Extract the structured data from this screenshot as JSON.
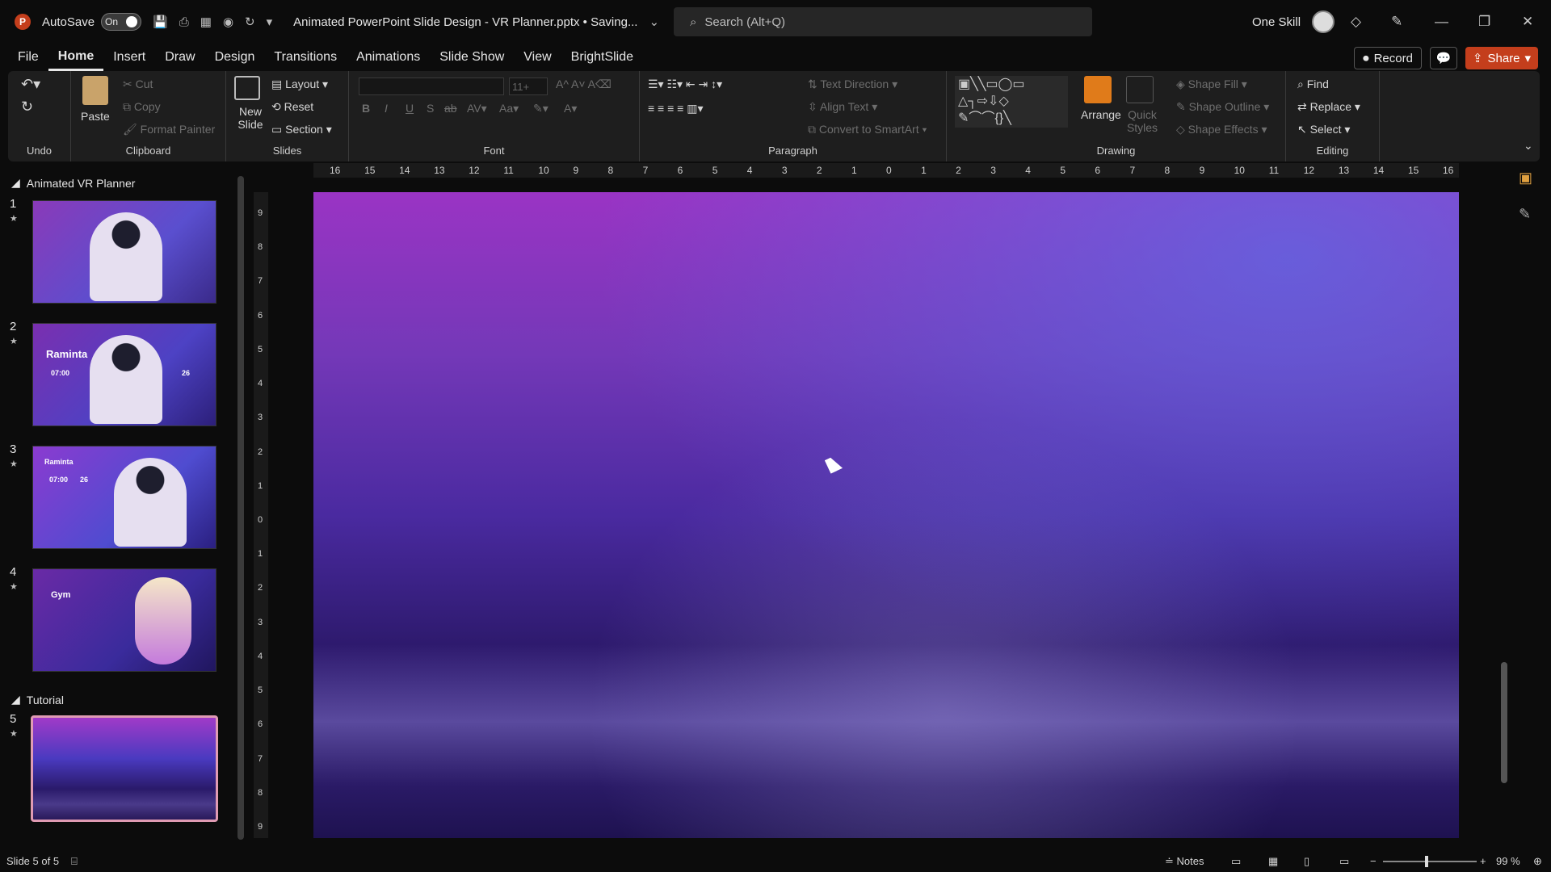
{
  "titlebar": {
    "app_icon": "P",
    "autosave_label": "AutoSave",
    "autosave_state": "On",
    "doc_title": "Animated PowerPoint Slide Design - VR Planner.pptx • Saving...",
    "search_placeholder": "Search (Alt+Q)",
    "user_name": "One Skill"
  },
  "menu": {
    "tabs": [
      "File",
      "Home",
      "Insert",
      "Draw",
      "Design",
      "Transitions",
      "Animations",
      "Slide Show",
      "View",
      "BrightSlide"
    ],
    "active": "Home",
    "record_label": "Record",
    "share_label": "Share"
  },
  "ribbon": {
    "undo": {
      "label": "Undo"
    },
    "clipboard": {
      "label": "Clipboard",
      "paste": "Paste",
      "cut": "Cut",
      "copy": "Copy",
      "format_painter": "Format Painter"
    },
    "slides": {
      "label": "Slides",
      "new_slide": "New Slide",
      "layout": "Layout",
      "reset": "Reset",
      "section": "Section"
    },
    "font": {
      "label": "Font",
      "size": "11+"
    },
    "paragraph": {
      "label": "Paragraph",
      "text_direction": "Text Direction",
      "align_text": "Align Text",
      "convert_smartart": "Convert to SmartArt"
    },
    "drawing": {
      "label": "Drawing",
      "arrange": "Arrange",
      "quick_styles": "Quick Styles",
      "shape_fill": "Shape Fill",
      "shape_outline": "Shape Outline",
      "shape_effects": "Shape Effects"
    },
    "editing": {
      "label": "Editing",
      "find": "Find",
      "replace": "Replace",
      "select": "Select"
    }
  },
  "slides_panel": {
    "section1": "Animated VR Planner",
    "section2": "Tutorial",
    "slides": [
      {
        "num": "1"
      },
      {
        "num": "2",
        "text_a": "Raminta",
        "text_b": "07:00",
        "text_c": "26"
      },
      {
        "num": "3",
        "text_a": "Raminta",
        "text_b": "07:00",
        "text_c": "26"
      },
      {
        "num": "4",
        "text_a": "Gym"
      },
      {
        "num": "5"
      }
    ]
  },
  "ruler": {
    "h_ticks": [
      "16",
      "15",
      "14",
      "13",
      "12",
      "11",
      "10",
      "9",
      "8",
      "7",
      "6",
      "5",
      "4",
      "3",
      "2",
      "1",
      "0",
      "1",
      "2",
      "3",
      "4",
      "5",
      "6",
      "7",
      "8",
      "9",
      "10",
      "11",
      "12",
      "13",
      "14",
      "15",
      "16"
    ],
    "v_ticks": [
      "9",
      "8",
      "7",
      "6",
      "5",
      "4",
      "3",
      "2",
      "1",
      "0",
      "1",
      "2",
      "3",
      "4",
      "5",
      "6",
      "7",
      "8",
      "9"
    ]
  },
  "status": {
    "slide_info": "Slide 5 of 5",
    "notes": "Notes",
    "zoom": "99 %"
  },
  "colors": {
    "accent_red": "#c43e1c",
    "selection": "#e09bb3",
    "share_bg": "#c43e1c"
  }
}
